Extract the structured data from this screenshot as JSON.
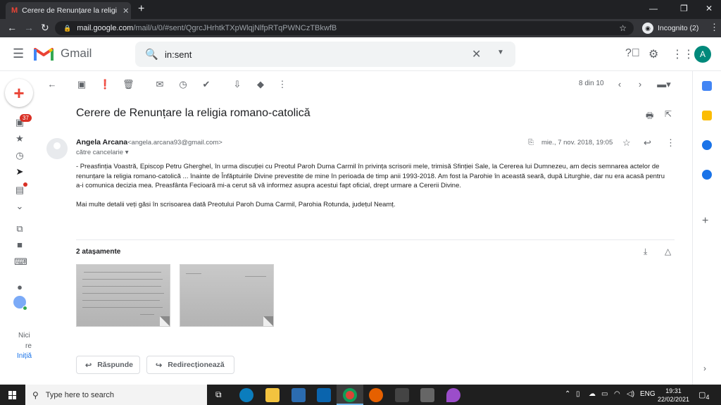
{
  "browser": {
    "tab_title": "Cerere de Renunțare la religia ro",
    "tab_icon": "M",
    "url_host": "mail.google.com",
    "url_path": "/mail/u/0/#sent/QgrcJHrhtkTXpWlqjNlfpRTqPWNCzTBkwfB",
    "incognito_label": "Incognito (2)"
  },
  "gmail": {
    "logo_text": "Gmail",
    "search_value": "in:sent",
    "account_initial": "A",
    "badge_count": "37",
    "rail_footer_line1": "Nici",
    "rail_footer_line2": "re",
    "rail_footer_link": "Inițiă"
  },
  "toolbar": {
    "page_count": "8 din 10"
  },
  "message": {
    "subject": "Cerere de Renunțare la religia romano-catolică",
    "sender_name": "Angela Arcana",
    "sender_email": "<angela.arcana93@gmail.com>",
    "to_line": "către cancelarie",
    "date": "mie., 7 nov. 2018, 19:05",
    "paragraph1": "- Preasfinția Voastră, Episcop Petru Gherghel, în urma discuției cu Preotul Paroh Duma Carmil în privința scrisorii mele, trimisă Sfinției Sale, la Cererea lui Dumnezeu, am decis semnarea actelor de renunțare la religia romano-catolică ... înainte de Înfăptuirile Divine prevestite de mine în perioada de timp anii 1993-2018. Am fost la Parohie în această seară, după Liturghie, dar nu era acasă pentru a-i comunica decizia mea. Preasfânta Fecioară mi-a cerut să vă informez asupra acestui fapt oficial, drept urmare a Cererii Divine.",
    "paragraph2": "Mai multe detalii veți găsi în scrisoarea dată Preotului Paroh Duma Carmil, Parohia Rotunda, județul Neamț.",
    "attachments_title": "2 atașamente",
    "reply_label": "Răspunde",
    "forward_label": "Redirecționează"
  },
  "taskbar": {
    "search_placeholder": "Type here to search",
    "lang": "ENG",
    "time": "19:31",
    "date": "22/02/2021",
    "notif_count": "4"
  },
  "colors": {
    "chrome_dark": "#202124",
    "gmail_red": "#ea4335",
    "accent_blue": "#1a73e8",
    "avatar_teal": "#00897b"
  }
}
